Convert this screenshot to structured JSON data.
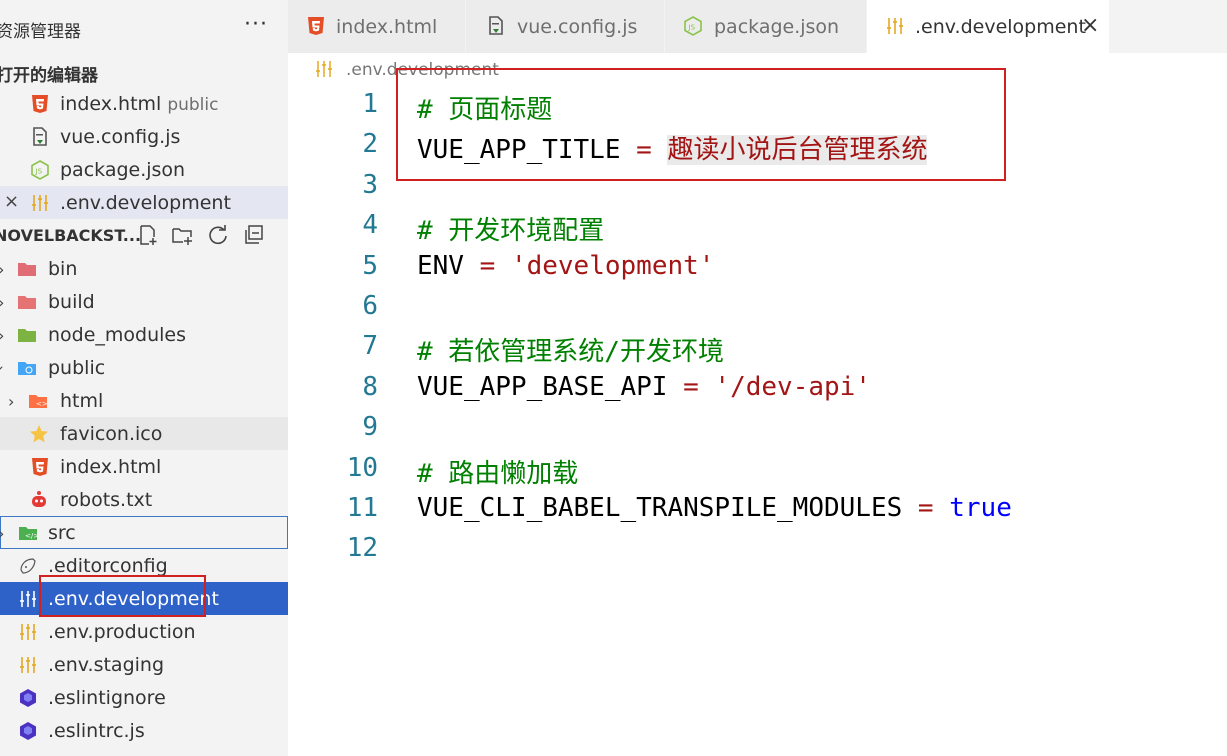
{
  "sidebar": {
    "title": "资源管理器",
    "more": "···",
    "open_editors": {
      "header": "打开的编辑器",
      "items": [
        {
          "name": "index.html",
          "desc": "public",
          "icon": "html5-icon"
        },
        {
          "name": "vue.config.js",
          "icon": "js-config-icon"
        },
        {
          "name": "package.json",
          "icon": "nodejs-icon"
        },
        {
          "name": ".env.development",
          "icon": "env-settings-icon",
          "close": "×"
        }
      ]
    },
    "folder": {
      "name": "NOVELBACKST...",
      "actions": [
        "new-file-icon",
        "new-folder-icon",
        "refresh-icon",
        "collapse-all-icon"
      ]
    },
    "tree": [
      {
        "name": "bin",
        "type": "folder",
        "expanded": false,
        "color": "#e06c75"
      },
      {
        "name": "build",
        "type": "folder",
        "expanded": false,
        "color": "#e06c75"
      },
      {
        "name": "node_modules",
        "type": "folder",
        "expanded": false,
        "color": "#7cb342"
      },
      {
        "name": "public",
        "type": "folder",
        "expanded": true,
        "color": "#42a5f5"
      },
      {
        "name": "html",
        "type": "folder",
        "expanded": false,
        "color": "#ff7043"
      },
      {
        "name": "favicon.ico",
        "type": "file",
        "icon": "star-icon"
      },
      {
        "name": "index.html",
        "type": "file",
        "icon": "html5-icon"
      },
      {
        "name": "robots.txt",
        "type": "file",
        "icon": "robot-icon"
      },
      {
        "name": "src",
        "type": "folder",
        "expanded": false,
        "color": "#4caf50"
      },
      {
        "name": ".editorconfig",
        "type": "file",
        "icon": "editorconfig-icon"
      },
      {
        "name": ".env.development",
        "type": "file",
        "icon": "env-settings-icon"
      },
      {
        "name": ".env.production",
        "type": "file",
        "icon": "env-settings-icon"
      },
      {
        "name": ".env.staging",
        "type": "file",
        "icon": "env-settings-icon"
      },
      {
        "name": ".eslintignore",
        "type": "file",
        "icon": "eslint-icon"
      },
      {
        "name": ".eslintrc.js",
        "type": "file",
        "icon": "eslint-icon"
      }
    ]
  },
  "tabs": [
    {
      "label": "index.html",
      "icon": "html5-icon"
    },
    {
      "label": "vue.config.js",
      "icon": "js-config-icon"
    },
    {
      "label": "package.json",
      "icon": "nodejs-icon"
    },
    {
      "label": ".env.development",
      "icon": "env-settings-icon",
      "active": true,
      "close": "×"
    }
  ],
  "breadcrumb": ".env.development",
  "editor": {
    "lines": [
      {
        "n": "1",
        "comment": "# 页面标题"
      },
      {
        "n": "2",
        "key": "VUE_APP_TITLE",
        "op": " = ",
        "value": "趣读小说后台管理系统",
        "vtype": "plain"
      },
      {
        "n": "3"
      },
      {
        "n": "4",
        "comment": "# 开发环境配置"
      },
      {
        "n": "5",
        "key": "ENV",
        "op": " = ",
        "value": "'development'",
        "vtype": "str"
      },
      {
        "n": "6"
      },
      {
        "n": "7",
        "comment": "# 若依管理系统/开发环境"
      },
      {
        "n": "8",
        "key": "VUE_APP_BASE_API",
        "op": " = ",
        "value": "'/dev-api'",
        "vtype": "str"
      },
      {
        "n": "9"
      },
      {
        "n": "10",
        "comment": "# 路由懒加载"
      },
      {
        "n": "11",
        "key": "VUE_CLI_BABEL_TRANSPILE_MODULES",
        "op": " = ",
        "value": "true",
        "vtype": "bool"
      },
      {
        "n": "12"
      }
    ]
  },
  "colors": {
    "accent_selected": "#2e62c9",
    "highlight_box": "#d02020",
    "comment": "#008000",
    "string": "#a31515",
    "boolean": "#0000ff",
    "line_number": "#237893"
  }
}
